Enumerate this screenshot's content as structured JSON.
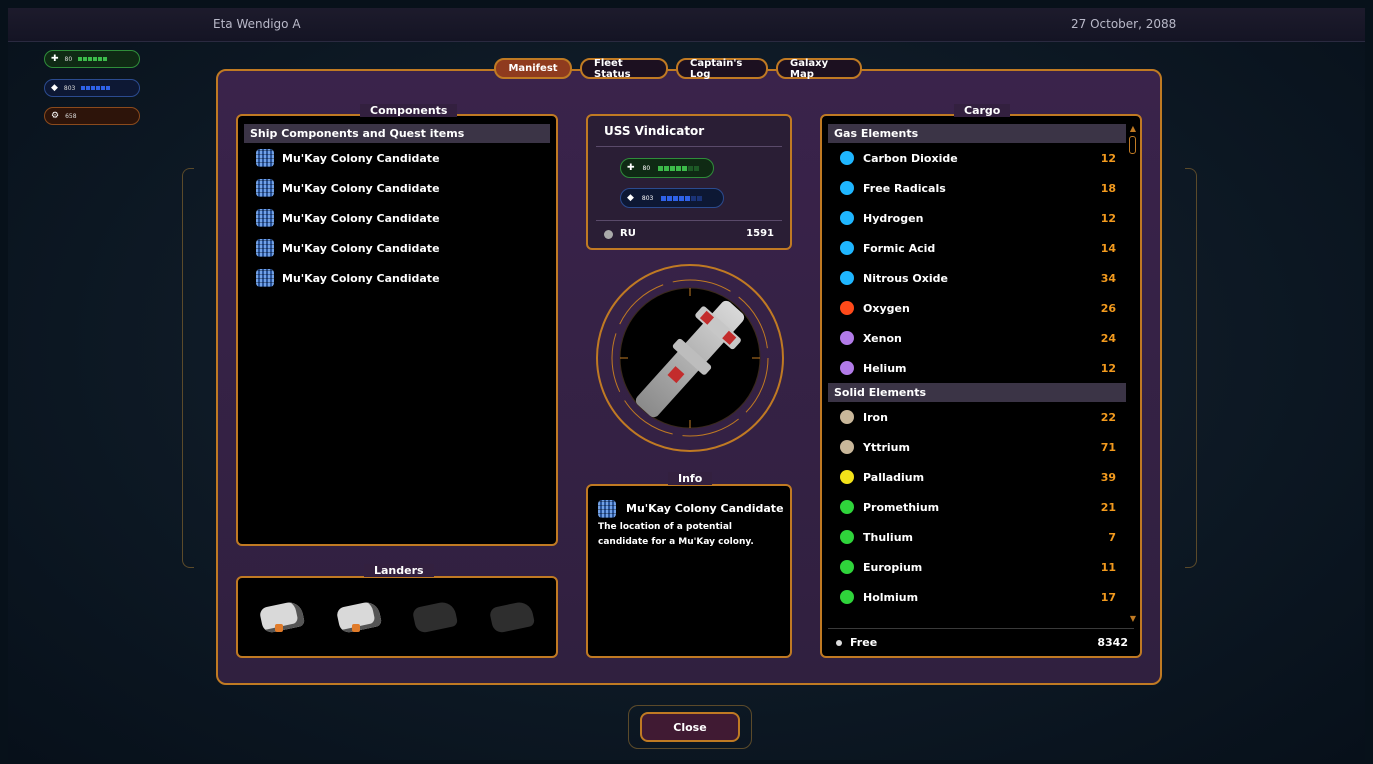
{
  "location": "Eta Wendigo A",
  "date": "27 October, 2088",
  "tabs": [
    {
      "label": "Manifest",
      "active": true
    },
    {
      "label": "Fleet Status",
      "active": false
    },
    {
      "label": "Captain's Log",
      "active": false
    },
    {
      "label": "Galaxy Map",
      "active": false
    }
  ],
  "components": {
    "title": "Components",
    "group": "Ship Components and Quest items",
    "items": [
      "Mu'Kay Colony Candidate",
      "Mu'Kay Colony Candidate",
      "Mu'Kay Colony Candidate",
      "Mu'Kay Colony Candidate",
      "Mu'Kay Colony Candidate"
    ]
  },
  "landers": {
    "title": "Landers",
    "active_count": 2,
    "total": 4
  },
  "ship": {
    "name": "USS Vindicator",
    "ru_label": "RU",
    "ru_value": "1591",
    "hull_value": "80",
    "shield_value": "803"
  },
  "info": {
    "title": "Info",
    "item_name": "Mu'Kay Colony Candidate",
    "description": "The location of a potential candidate for a Mu'Kay colony."
  },
  "cargo": {
    "title": "Cargo",
    "groups": [
      {
        "name": "Gas Elements",
        "items": [
          {
            "name": "Carbon Dioxide",
            "qty": "12",
            "color": "#1fb6ff"
          },
          {
            "name": "Free Radicals",
            "qty": "18",
            "color": "#1fb6ff"
          },
          {
            "name": "Hydrogen",
            "qty": "12",
            "color": "#1fb6ff"
          },
          {
            "name": "Formic Acid",
            "qty": "14",
            "color": "#1fb6ff"
          },
          {
            "name": "Nitrous Oxide",
            "qty": "34",
            "color": "#1fb6ff"
          },
          {
            "name": "Oxygen",
            "qty": "26",
            "color": "#ff4a1a"
          },
          {
            "name": "Xenon",
            "qty": "24",
            "color": "#b27be8"
          },
          {
            "name": "Helium",
            "qty": "12",
            "color": "#b27be8"
          }
        ]
      },
      {
        "name": "Solid Elements",
        "items": [
          {
            "name": "Iron",
            "qty": "22",
            "color": "#c9b79a"
          },
          {
            "name": "Yttrium",
            "qty": "71",
            "color": "#c9b79a"
          },
          {
            "name": "Palladium",
            "qty": "39",
            "color": "#f3e219"
          },
          {
            "name": "Promethium",
            "qty": "21",
            "color": "#2fd43b"
          },
          {
            "name": "Thulium",
            "qty": "7",
            "color": "#2fd43b"
          },
          {
            "name": "Europium",
            "qty": "11",
            "color": "#2fd43b"
          },
          {
            "name": "Holmium",
            "qty": "17",
            "color": "#2fd43b"
          }
        ]
      }
    ],
    "free_label": "Free",
    "free_value": "8342"
  },
  "mini_stats": [
    {
      "value": "80"
    },
    {
      "value": "803"
    },
    {
      "value": "658"
    }
  ],
  "close_label": "Close"
}
